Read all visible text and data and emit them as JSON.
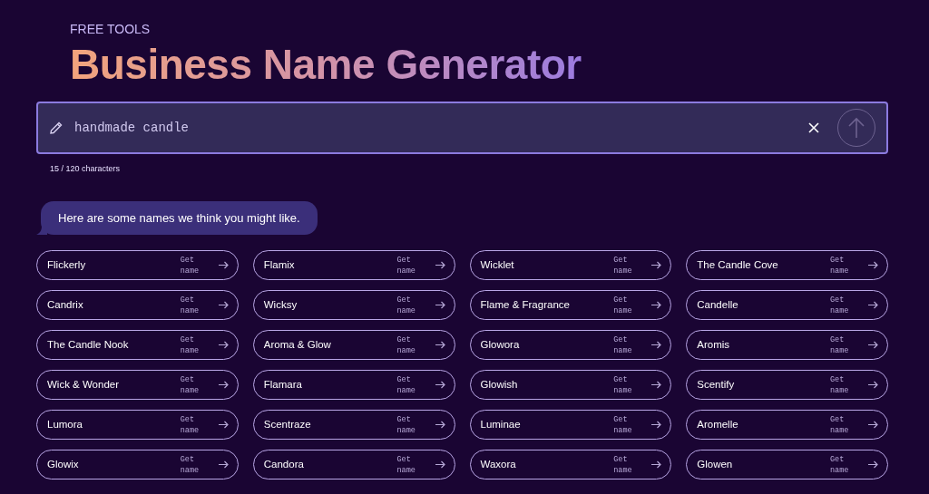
{
  "eyebrow": "FREE TOOLS",
  "title": "Business Name Generator",
  "prompt": {
    "value": "handmade candle",
    "counter": "15 / 120 characters"
  },
  "message": "Here are some names we think you might like.",
  "names": [
    {
      "name": "Flickerly",
      "action": "Get name"
    },
    {
      "name": "Flamix",
      "action": "Get name"
    },
    {
      "name": "Wicklet",
      "action": "Get name"
    },
    {
      "name": "The Candle Cove",
      "action": "Get name"
    },
    {
      "name": "Candrix",
      "action": "Get name"
    },
    {
      "name": "Wicksy",
      "action": "Get name"
    },
    {
      "name": "Flame & Fragrance",
      "action": "Get name"
    },
    {
      "name": "Candelle",
      "action": "Get name"
    },
    {
      "name": "The Candle Nook",
      "action": "Get name"
    },
    {
      "name": "Aroma & Glow",
      "action": "Get name"
    },
    {
      "name": "Glowora",
      "action": "Get name"
    },
    {
      "name": "Aromis",
      "action": "Get name"
    },
    {
      "name": "Wick & Wonder",
      "action": "Get name"
    },
    {
      "name": "Flamara",
      "action": "Get name"
    },
    {
      "name": "Glowish",
      "action": "Get name"
    },
    {
      "name": "Scentify",
      "action": "Get name"
    },
    {
      "name": "Lumora",
      "action": "Get name"
    },
    {
      "name": "Scentraze",
      "action": "Get name"
    },
    {
      "name": "Luminae",
      "action": "Get name"
    },
    {
      "name": "Aromelle",
      "action": "Get name"
    },
    {
      "name": "Glowix",
      "action": "Get name"
    },
    {
      "name": "Candora",
      "action": "Get name"
    },
    {
      "name": "Waxora",
      "action": "Get name"
    },
    {
      "name": "Glowen",
      "action": "Get name"
    }
  ]
}
